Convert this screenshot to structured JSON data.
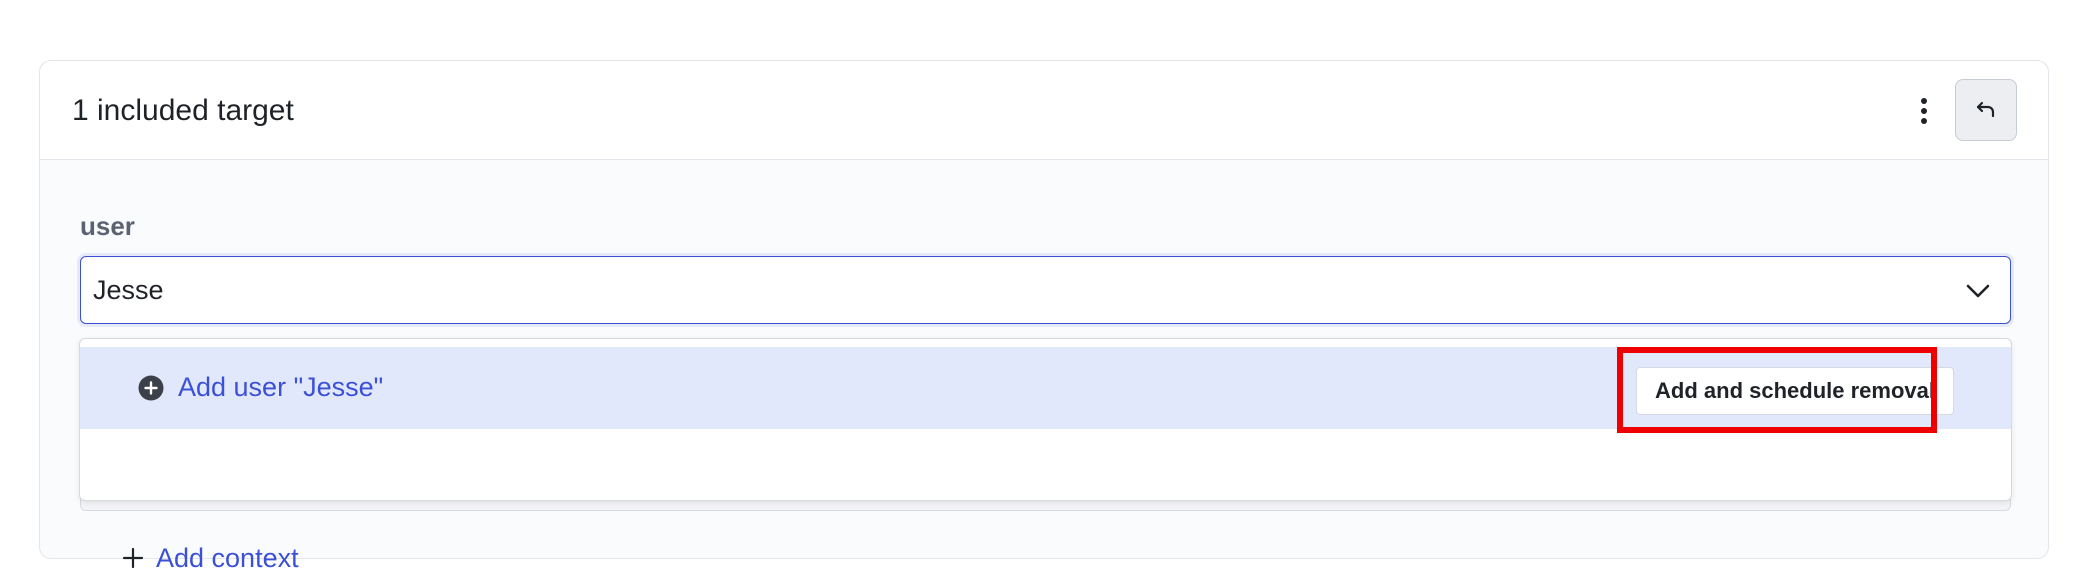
{
  "targets": {
    "title": "1 included target"
  },
  "context_field": {
    "label": "user",
    "value": "Jesse"
  },
  "dropdown": {
    "option_label": "Add user \"Jesse\"",
    "schedule_button_label": "Add and schedule removal"
  },
  "footer": {
    "add_context_label": "Add context"
  },
  "icons": {
    "menu": "more-vertical-icon",
    "undo": "undo-icon",
    "chevron": "chevron-down-icon",
    "add_option": "plus-circle-icon",
    "add_context": "plus-icon"
  },
  "colors": {
    "accent": "#3b50d6",
    "option_highlight": "#e2e8fb",
    "annotation": "#ee0000"
  }
}
